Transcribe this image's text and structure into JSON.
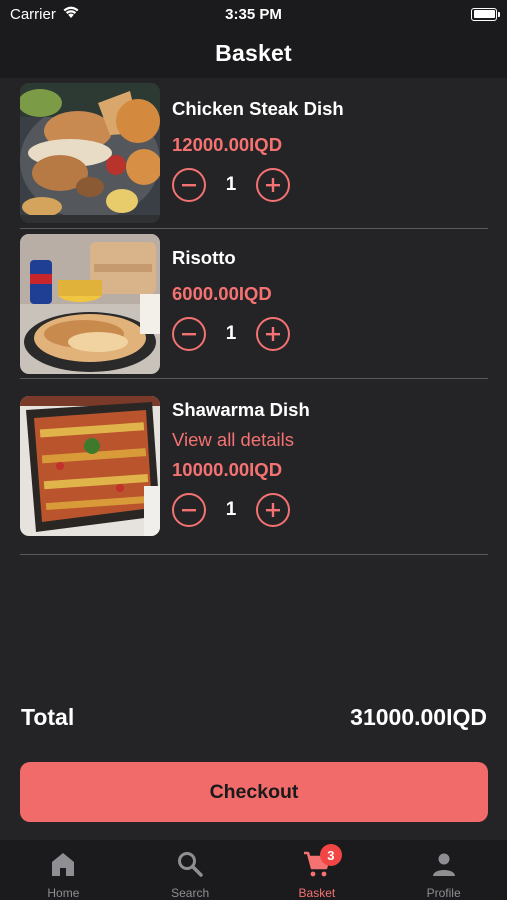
{
  "status_bar": {
    "carrier": "Carrier",
    "time": "3:35 PM"
  },
  "header": {
    "title": "Basket"
  },
  "items": [
    {
      "name": "Chicken Steak Dish",
      "price": "12000.00IQD",
      "quantity": "1",
      "image_icon": "chicken-steak-image"
    },
    {
      "name": "Risotto",
      "price": "6000.00IQD",
      "quantity": "1",
      "image_icon": "risotto-image"
    },
    {
      "name": "Shawarma Dish",
      "link": "View all details",
      "price": "10000.00IQD",
      "quantity": "1",
      "image_icon": "shawarma-image"
    }
  ],
  "total": {
    "label": "Total",
    "value": "31000.00IQD"
  },
  "checkout": {
    "label": "Checkout"
  },
  "tabs": [
    {
      "label": "Home",
      "icon": "home-icon"
    },
    {
      "label": "Search",
      "icon": "search-icon"
    },
    {
      "label": "Basket",
      "icon": "cart-icon",
      "badge": "3",
      "active": true
    },
    {
      "label": "Profile",
      "icon": "person-icon"
    }
  ],
  "colors": {
    "accent": "#f47272",
    "button": "#f26b6b",
    "background": "#242426",
    "bar": "#1b1b1d",
    "badge": "#f24545"
  }
}
